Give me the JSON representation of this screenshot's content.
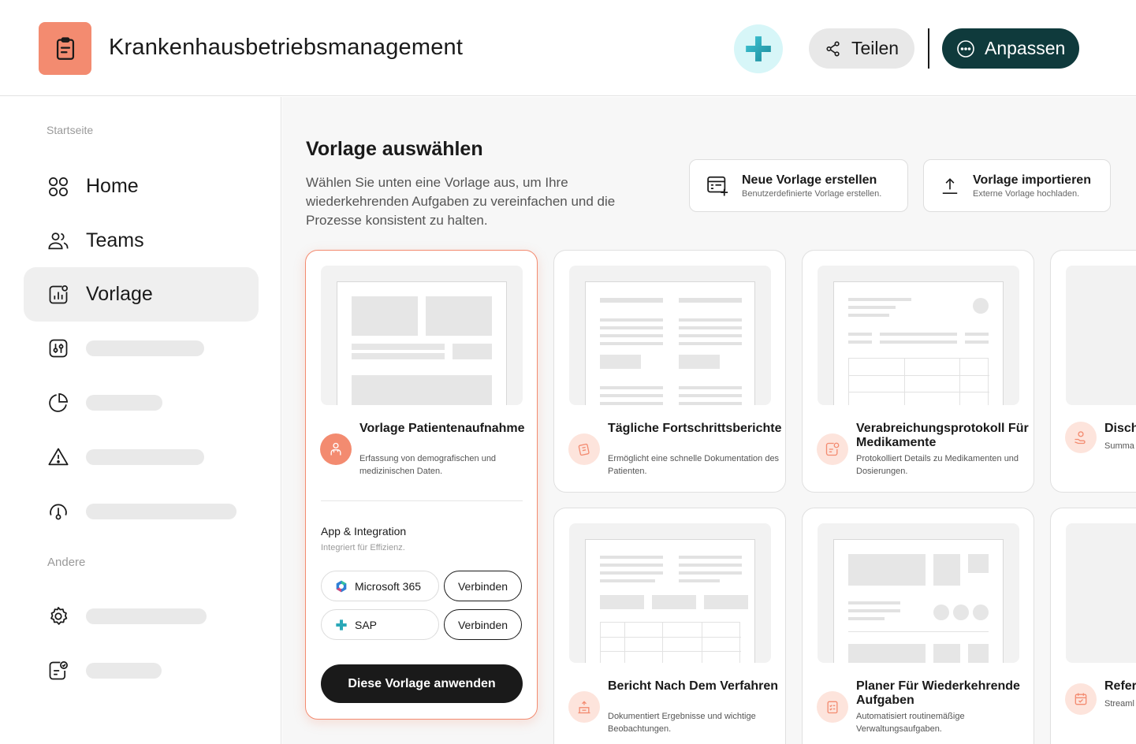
{
  "header": {
    "title": "Krankenhausbetriebsmanagement",
    "share_label": "Teilen",
    "customize_label": "Anpassen",
    "accent_color": "#f38b70",
    "dark_color": "#0f3a3c"
  },
  "sidebar": {
    "section_home": "Startseite",
    "section_other": "Andere",
    "items": [
      {
        "label": "Home",
        "icon": "grid-icon"
      },
      {
        "label": "Teams",
        "icon": "users-icon"
      },
      {
        "label": "Vorlage",
        "icon": "template-chart-icon",
        "active": true
      }
    ],
    "placeholder_icons": [
      "sliders-icon",
      "pie-chart-icon",
      "alert-icon",
      "gauge-icon",
      "settings-icon",
      "task-check-icon"
    ]
  },
  "main": {
    "title": "Vorlage auswählen",
    "description": "Wählen Sie unten eine Vorlage aus, um Ihre wiederkehrenden Aufgaben zu vereinfachen und die Prozesse konsistent zu halten.",
    "new_template": {
      "title": "Neue Vorlage erstellen",
      "subtitle": "Benutzerdefinierte Vorlage erstellen."
    },
    "import_template": {
      "title": "Vorlage importieren",
      "subtitle": "Externe Vorlage hochladen."
    }
  },
  "cards": [
    {
      "title": "Vorlage Patientenaufnahme",
      "description": "Erfassung von demografischen und medizinischen Daten."
    },
    {
      "title": "Tägliche Fortschrittsberichte",
      "description": "Ermöglicht eine schnelle Dokumentation des Patienten."
    },
    {
      "title": "Verabreichungsprotokoll Für Medikamente",
      "description": "Protokolliert Details zu Medikamenten und Dosierungen."
    },
    {
      "title": "Disch",
      "description": "Summa"
    },
    {
      "title": "Bericht Nach Dem Verfahren",
      "description": "Dokumentiert Ergebnisse und wichtige Beobachtungen."
    },
    {
      "title": "Planer Für Wiederkehrende Aufgaben",
      "description": "Automatisiert routinemäßige Verwaltungsaufgaben."
    },
    {
      "title": "Refer",
      "description": "Streaml patients"
    }
  ],
  "integration": {
    "title": "App & Integration",
    "subtitle": "Integriert für Effizienz.",
    "apps": [
      {
        "name": "Microsoft 365",
        "action": "Verbinden"
      },
      {
        "name": "SAP",
        "action": "Verbinden"
      }
    ],
    "apply_label": "Diese Vorlage anwenden"
  }
}
